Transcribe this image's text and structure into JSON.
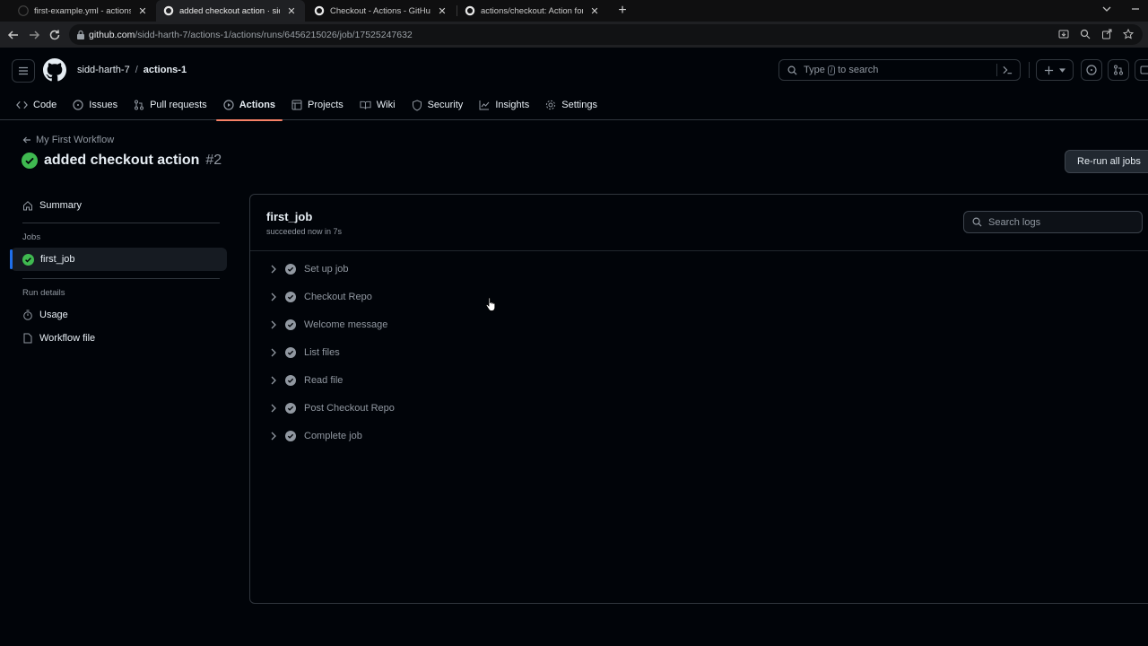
{
  "browser": {
    "tabs": [
      {
        "title": "first-example.yml - actions-1 [Gi",
        "active": false
      },
      {
        "title": "added checkout action · sidd-ha",
        "active": true
      },
      {
        "title": "Checkout - Actions - GitHub Ma",
        "active": false
      },
      {
        "title": "actions/checkout: Action for che",
        "active": false
      }
    ],
    "url_host": "github.com",
    "url_path": "/sidd-harth-7/actions-1/actions/runs/6456215026/job/17525247632"
  },
  "header": {
    "owner": "sidd-harth-7",
    "separator": "/",
    "repo": "actions-1",
    "search_type": "Type",
    "search_key": "/",
    "search_suffix": "to search"
  },
  "repo_nav": [
    {
      "label": "Code",
      "icon": "code-icon",
      "selected": false
    },
    {
      "label": "Issues",
      "icon": "issue-icon",
      "selected": false
    },
    {
      "label": "Pull requests",
      "icon": "pull-request-icon",
      "selected": false
    },
    {
      "label": "Actions",
      "icon": "actions-play-icon",
      "selected": true
    },
    {
      "label": "Projects",
      "icon": "table-icon",
      "selected": false
    },
    {
      "label": "Wiki",
      "icon": "book-icon",
      "selected": false
    },
    {
      "label": "Security",
      "icon": "shield-icon",
      "selected": false
    },
    {
      "label": "Insights",
      "icon": "graph-icon",
      "selected": false
    },
    {
      "label": "Settings",
      "icon": "gear-icon",
      "selected": false
    }
  ],
  "run": {
    "back_label": "My First Workflow",
    "title": "added checkout action",
    "number": "#2",
    "rerun_label": "Re-run all jobs",
    "status_color": "#3fb950"
  },
  "sidebar": {
    "summary_label": "Summary",
    "jobs_heading": "Jobs",
    "jobs": [
      {
        "label": "first_job",
        "selected": true
      }
    ],
    "run_details_heading": "Run details",
    "details": [
      {
        "label": "Usage",
        "icon": "stopwatch-icon"
      },
      {
        "label": "Workflow file",
        "icon": "file-icon"
      }
    ]
  },
  "job": {
    "name": "first_job",
    "status": "succeeded now in 7s",
    "search_placeholder": "Search logs",
    "steps": [
      "Set up job",
      "Checkout Repo",
      "Welcome message",
      "List files",
      "Read file",
      "Post Checkout Repo",
      "Complete job"
    ]
  }
}
